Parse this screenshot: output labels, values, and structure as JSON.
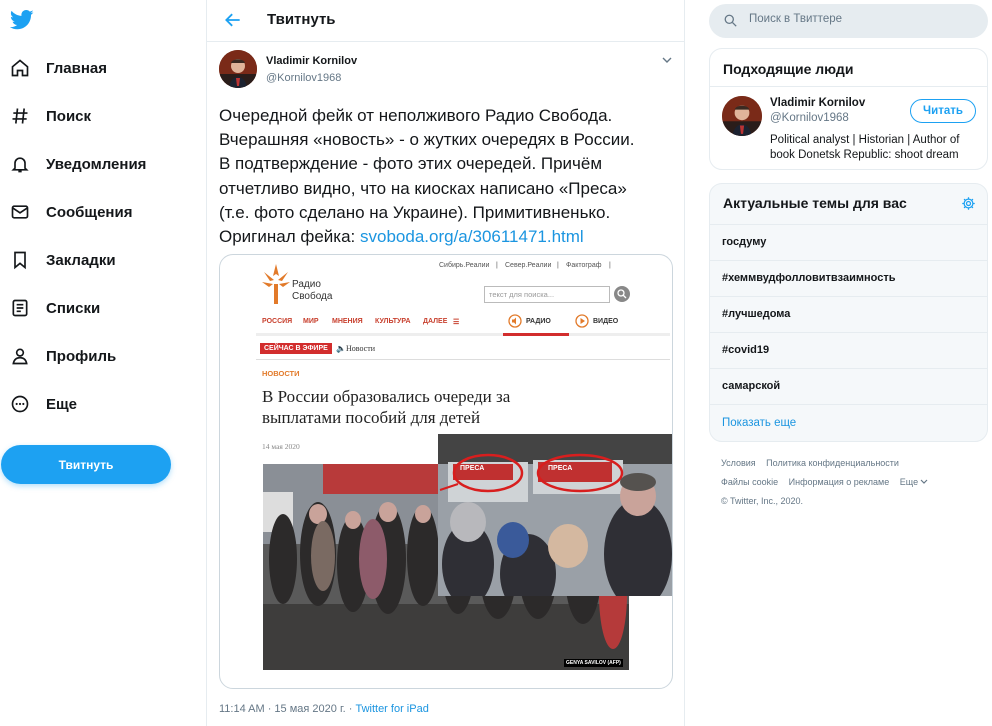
{
  "nav": {
    "items": [
      {
        "label": "Главная",
        "icon": "home-icon"
      },
      {
        "label": "Поиск",
        "icon": "hashtag-icon"
      },
      {
        "label": "Уведомления",
        "icon": "bell-icon"
      },
      {
        "label": "Сообщения",
        "icon": "envelope-icon"
      },
      {
        "label": "Закладки",
        "icon": "bookmark-icon"
      },
      {
        "label": "Списки",
        "icon": "list-icon"
      },
      {
        "label": "Профиль",
        "icon": "person-icon"
      },
      {
        "label": "Еще",
        "icon": "more-circle-icon"
      }
    ],
    "tweet_button": "Твитнуть"
  },
  "header": {
    "title": "Твитнуть"
  },
  "tweet": {
    "author_name": "Vladimir Kornilov",
    "author_handle": "@Kornilov1968",
    "text_lines": [
      "Очередной фейк от неполживого Радио Свобода.",
      "Вчерашняя «новость» - о жутких очередях в России.",
      "В подтверждение - фото этих очередей. Причём",
      "отчетливо видно, что на киосках написано «Преса»",
      "(т.е. фото сделано на Украине). Примитивненько.",
      "Оригинал фейка: "
    ],
    "link_text": "svoboda.org/a/30611471.html",
    "time": "11:14 AM · 15 мая 2020 г. · ",
    "source": "Twitter for iPad"
  },
  "embed": {
    "logo_line1": "Радио",
    "logo_line2": "Свобода",
    "top_links": [
      "Сибирь.Реалии",
      "|",
      "Север.Реалии",
      "|",
      "Фактограф",
      "|"
    ],
    "search_placeholder": "текст для поиска...",
    "menu": [
      "РОССИЯ",
      "МИР",
      "МНЕНИЯ",
      "КУЛЬТУРА",
      "ДАЛЕЕ"
    ],
    "radio": "РАДИО",
    "video": "ВИДЕО",
    "live": "СЕЙЧАС В ЭФИРЕ",
    "news_label": "Новости",
    "category": "НОВОСТИ",
    "headline_line1": "В России образовались очереди за",
    "headline_line2": "выплатами пособий для детей",
    "date": "14 мая 2020",
    "kiosk_sign": "ПРЕСА",
    "photo_credit": "GENYA SAVILOV (AFP)"
  },
  "sidebar": {
    "search_placeholder": "Поиск в Твиттере",
    "who_title": "Подходящие люди",
    "who": {
      "name": "Vladimir Kornilov",
      "handle": "@Kornilov1968",
      "bio": "Political analyst | Historian | Author of book Donetsk Republic: shoot dream",
      "follow": "Читать"
    },
    "trends_title": "Актуальные темы для вас",
    "trends": [
      "госдуму",
      "#хеммвудфолловитвзаимность",
      "#лучшедома",
      "#covid19",
      "самарской"
    ],
    "show_more": "Показать еще",
    "footer_line1": [
      "Условия",
      "Политика конфиденциальности"
    ],
    "footer_line2": [
      "Файлы cookie",
      "Информация о рекламе",
      "Еще"
    ],
    "footer_copyright": "© Twitter, Inc., 2020."
  },
  "colors": {
    "accent": "#1da1f2",
    "link": "#1b95e0",
    "rfe_red": "#d22d2d",
    "rfe_orange": "#e27a2a"
  }
}
